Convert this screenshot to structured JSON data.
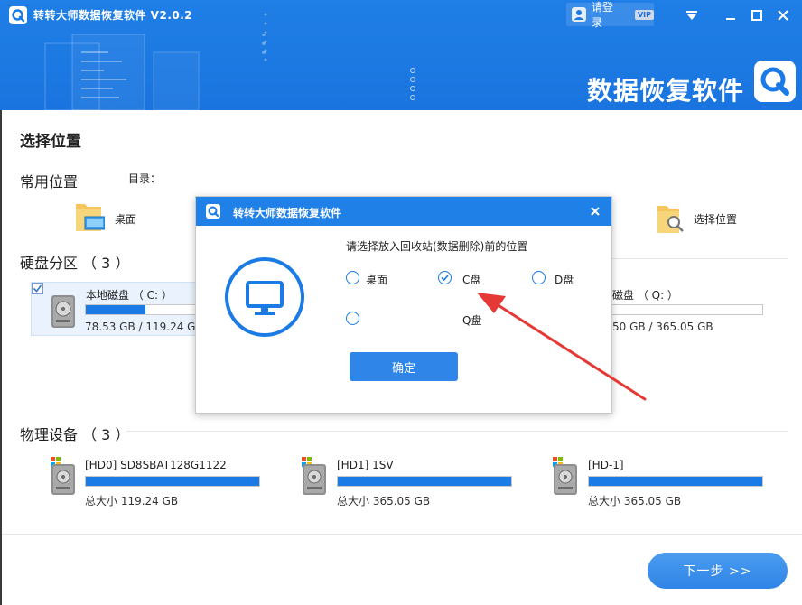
{
  "window": {
    "title": "转转大师数据恢复软件 V2.0.2",
    "login_label": "请登录",
    "vip_badge": "VIP",
    "brand_text": "数据恢复软件"
  },
  "main": {
    "page_title": "选择位置",
    "common": {
      "title": "常用位置",
      "dir_label": "目录：",
      "items": [
        {
          "label": "桌面",
          "icon": "desktop-folder-icon"
        },
        {
          "label": "选择位置",
          "icon": "folder-icon"
        }
      ]
    },
    "partitions": {
      "title": "硬盘分区 （ 3 ）",
      "items": [
        {
          "name": "本地磁盘 （ C: ）",
          "size": "78.53 GB / 119.24 GB",
          "used_fraction": 0.52,
          "checked": true
        },
        {
          "name": "磁盘 （ Q: ）",
          "size": "50 GB / 365.05 GB",
          "used_fraction": 0.0,
          "checked": false
        }
      ]
    },
    "devices": {
      "title": "物理设备 （ 3 ）",
      "items": [
        {
          "name": "[HD0] SD8SBAT128G1122",
          "size": "总大小 119.24 GB",
          "used_fraction": 1.0
        },
        {
          "name": "[HD1] 1SV",
          "size": "总大小 365.05 GB",
          "used_fraction": 1.0
        },
        {
          "name": "[HD-1]",
          "size": "总大小 365.05 GB",
          "used_fraction": 1.0
        }
      ]
    },
    "next_label": "下一步 >>"
  },
  "dialog": {
    "title": "转转大师数据恢复软件",
    "prompt": "请选择放入回收站(数据删除)前的位置",
    "options": [
      {
        "label": "桌面",
        "selected": false
      },
      {
        "label": "C盘",
        "selected": true
      },
      {
        "label": "D盘",
        "selected": false
      },
      {
        "label": "Q盘",
        "selected": false
      }
    ],
    "ok_label": "确定"
  },
  "colors": {
    "accent": "#1a7ae6",
    "header_blue": "#1f7fe6",
    "annotation_red": "#e53935"
  }
}
